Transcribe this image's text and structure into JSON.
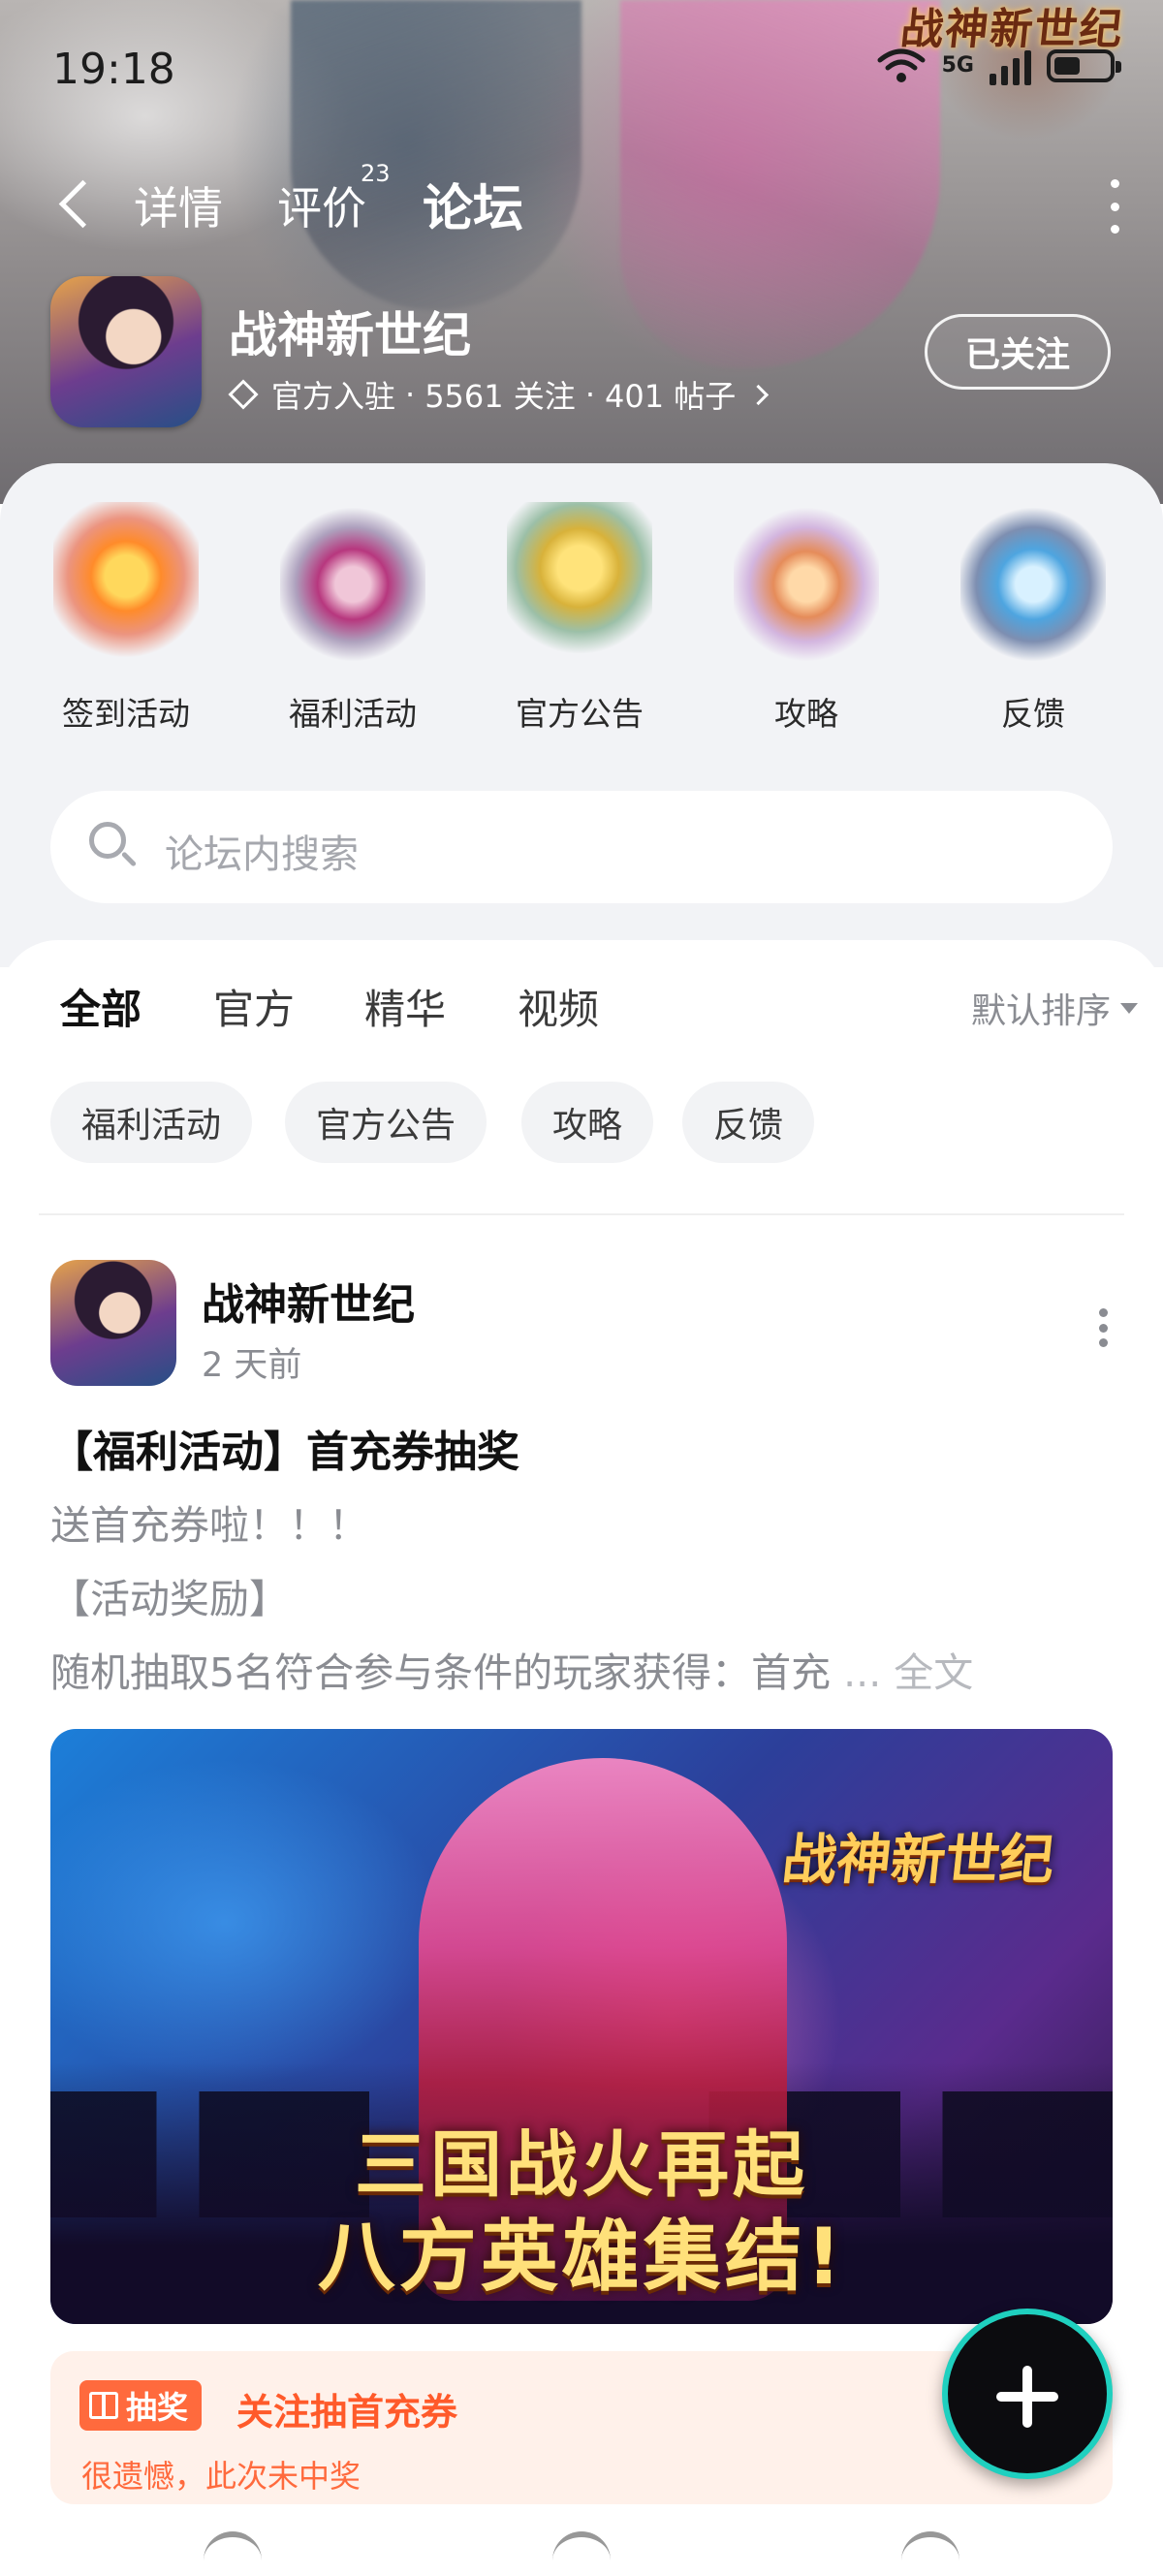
{
  "status_bar": {
    "time": "19:18",
    "network": "5G"
  },
  "header": {
    "art_logo": "战神新世纪",
    "tabs": [
      {
        "label": "详情"
      },
      {
        "label": "评价",
        "badge": "23"
      },
      {
        "label": "论坛",
        "active": true
      }
    ]
  },
  "game": {
    "name": "战神新世纪",
    "badge_text": "官方入驻",
    "followers": "5561 关注",
    "posts": "401 帖子",
    "follow_button": "已关注"
  },
  "quick_links": [
    {
      "label": "签到活动"
    },
    {
      "label": "福利活动"
    },
    {
      "label": "官方公告"
    },
    {
      "label": "攻略"
    },
    {
      "label": "反馈"
    }
  ],
  "search": {
    "placeholder": "论坛内搜索"
  },
  "feed": {
    "tabs": [
      {
        "label": "全部",
        "active": true
      },
      {
        "label": "官方"
      },
      {
        "label": "精华"
      },
      {
        "label": "视频"
      }
    ],
    "sort_label": "默认排序",
    "filter_chips": [
      "福利活动",
      "官方公告",
      "攻略",
      "反馈"
    ]
  },
  "post": {
    "author": "战神新世纪",
    "time": "2 天前",
    "title": "【福利活动】首充券抽奖",
    "lines": [
      "送首充券啦！！！",
      "【活动奖励】",
      "随机抽取5名符合参与条件的玩家获得：首充"
    ],
    "more_text": "... 全文",
    "banner": {
      "logo": "战神新世纪",
      "line1": "三国战火再起",
      "line2": "八方英雄集结!"
    },
    "lottery": {
      "tag": "抽奖",
      "title": "关注抽首充券",
      "result": "很遗憾，此次未中奖"
    }
  },
  "colors": {
    "accent": "#2ed3c2",
    "lottery": "#ff6a3d"
  }
}
